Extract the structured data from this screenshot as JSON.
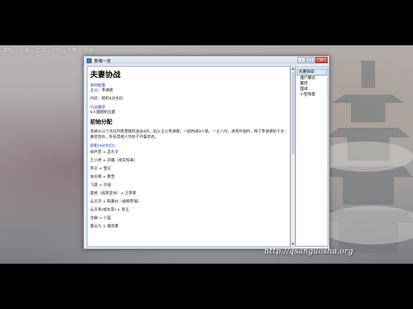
{
  "menubar": [
    "游戏",
    "设置",
    "工具",
    "DIY",
    "作弊",
    "帮助"
  ],
  "window": {
    "title": "新增一览",
    "buttons": {
      "minimize": "–",
      "maximize": "□",
      "close": "✕"
    }
  },
  "document": {
    "heading1": "夫妻协战",
    "section_identity": "身份配置",
    "lord_line": "主公：李渊德",
    "traitor_line": "内奸：随机4对夫妇",
    "section_order": "行动顺序",
    "order_line": "9人围随机位置",
    "heading2": "初始分配",
    "intro_text": "系统从以下夫妇列表里随机选出4对，加上主公李渊德，一起构成9人局，一主八内，游戏开始时，除了李渊德处于夫妻状态外，所有其他人均处于坏蛋状态。",
    "couples_title": "原配(4对夫妇)：",
    "couples": [
      "帖怀勇 + 孟乐文",
      "王小虎 + 苏媚（成实知画）",
      "李天 + 雪见",
      "徐长卿 + 紫萱",
      "飞蓬 + 夕瑶",
      "夏侯（成宾宣信）+ 王莲荤",
      "云天河 + 韩菱纱（或柳梦璃）",
      "云天青(或玄霄) + 夙玉",
      "龙幽 + 小蛮",
      "姜云凡 + 唐雨柔"
    ]
  },
  "toc": {
    "items": [
      {
        "label": "夫妻协战",
        "selected": true,
        "level": 0
      },
      {
        "label": "僵尸模式",
        "selected": false,
        "level": 1
      },
      {
        "label": "鳌拜",
        "selected": false,
        "level": 1
      },
      {
        "label": "国战",
        "selected": false,
        "level": 1
      },
      {
        "label": "小型场景",
        "selected": false,
        "level": 1
      }
    ]
  },
  "watermark": "http://qsanguosha.org",
  "colors": {
    "link_blue": "#1c3fa3",
    "window_bg": "#e6edf5",
    "selection": "#dbe7f6"
  }
}
